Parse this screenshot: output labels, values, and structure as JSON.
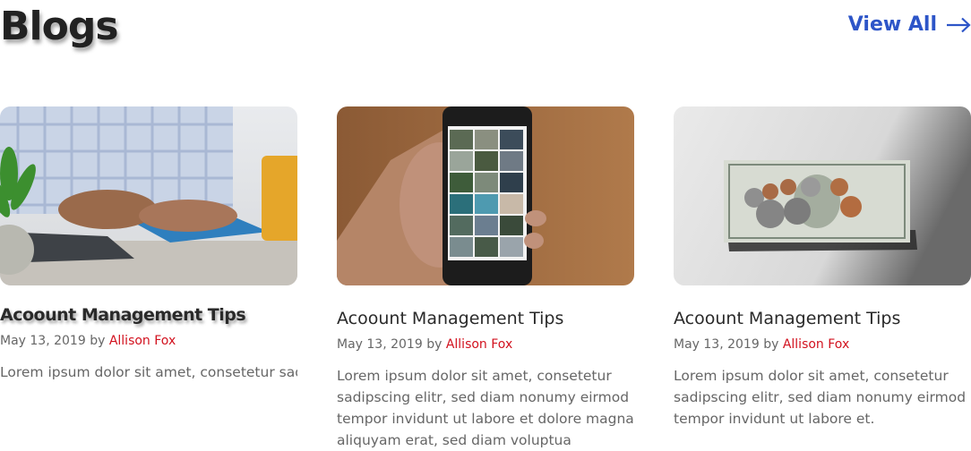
{
  "header": {
    "title": "Blogs",
    "view_all_label": "View All",
    "view_all_icon": "arrow-right-icon",
    "accent": "#2d55c8"
  },
  "cards": [
    {
      "title": "Acoount Management Tips",
      "date": "May 13, 2019",
      "by": "by",
      "author": "Allison Fox",
      "excerpt": "Lorem ipsum dolor sit amet, consetetur sadip",
      "image": "person-using-calculator-image"
    },
    {
      "title": "Acoount Management Tips",
      "date": "May 13, 2019",
      "by": "by",
      "author": "Allison Fox",
      "excerpt": "Lorem ipsum dolor sit amet, consetetur sadipscing elitr, sed diam nonumy eirmod tempor invidunt ut labore et dolore magna aliquyam erat, sed diam voluptua",
      "image": "hand-holding-phone-image"
    },
    {
      "title": "Acoount Management Tips",
      "date": "May 13, 2019",
      "by": "by",
      "author": "Allison Fox",
      "excerpt": "Lorem ipsum dolor sit amet, consetetur sadipscing elitr, sed diam nonumy eirmod tempor invidunt ut labore et.",
      "image": "dollar-bill-coins-image"
    }
  ],
  "colors": {
    "author": "#d2121f",
    "text": "#666666",
    "title": "#2a2a2a"
  }
}
